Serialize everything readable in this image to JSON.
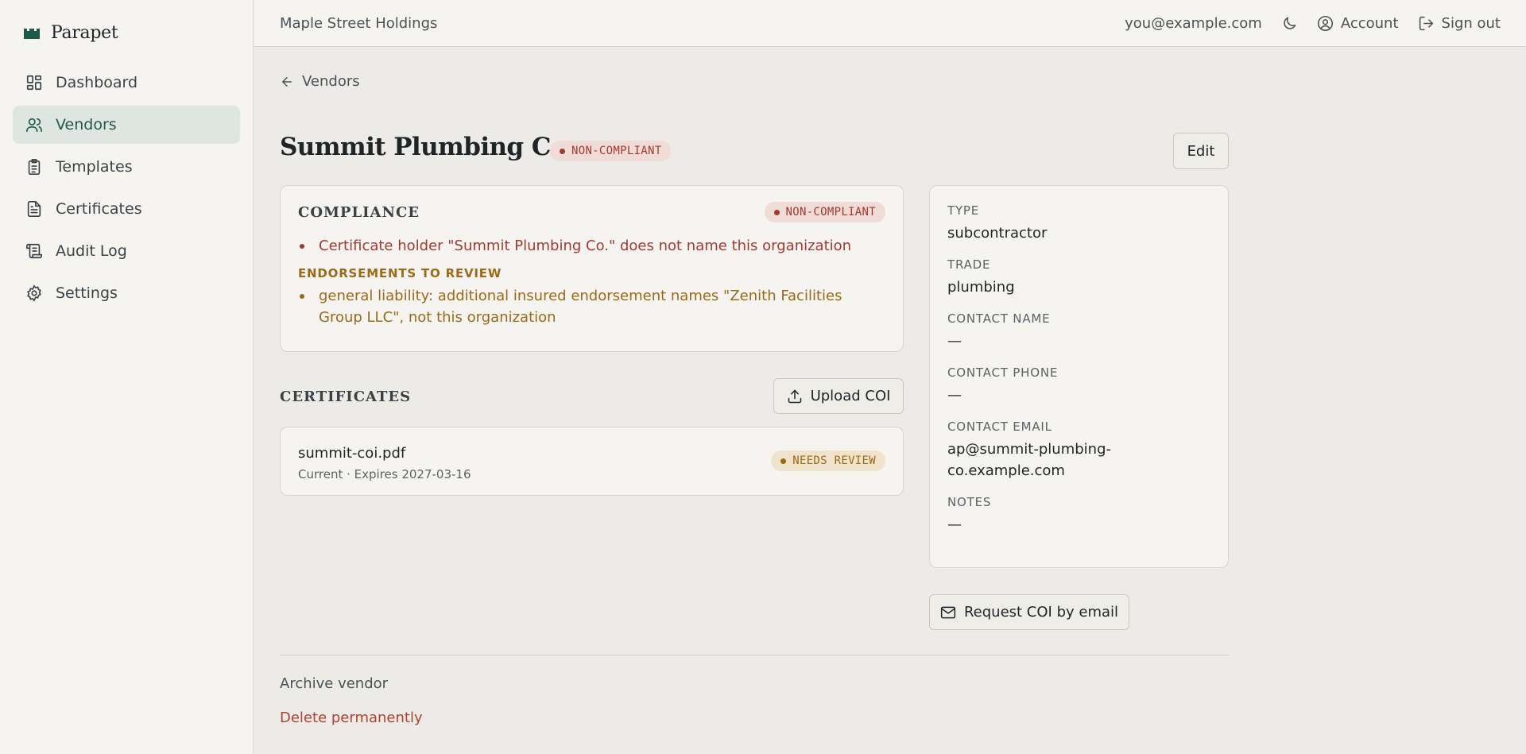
{
  "brand": {
    "name": "Parapet",
    "color": "#1d5a4c"
  },
  "sidebar": {
    "items": [
      {
        "label": "Dashboard",
        "icon": "dashboard-icon"
      },
      {
        "label": "Vendors",
        "icon": "users-icon",
        "active": true
      },
      {
        "label": "Templates",
        "icon": "clipboard-icon"
      },
      {
        "label": "Certificates",
        "icon": "document-icon"
      },
      {
        "label": "Audit Log",
        "icon": "scroll-icon"
      },
      {
        "label": "Settings",
        "icon": "gear-icon"
      }
    ]
  },
  "header": {
    "org_name": "Maple Street Holdings",
    "user_email": "you@example.com",
    "account_label": "Account",
    "signout_label": "Sign out"
  },
  "breadcrumb": {
    "back_label": "Vendors"
  },
  "vendor": {
    "name": "Summit Plumbing Co.",
    "status": "NON-COMPLIANT",
    "edit_label": "Edit"
  },
  "compliance": {
    "heading": "COMPLIANCE",
    "status": "NON-COMPLIANT",
    "issues": [
      "Certificate holder \"Summit Plumbing Co.\" does not name this organization"
    ],
    "endorsements_heading": "ENDORSEMENTS TO REVIEW",
    "endorsements": [
      "general liability: additional insured endorsement names \"Zenith Facilities Group LLC\", not this organization"
    ]
  },
  "certificates": {
    "heading": "CERTIFICATES",
    "upload_label": "Upload COI",
    "items": [
      {
        "filename": "summit-coi.pdf",
        "meta": "Current · Expires 2027-03-16",
        "status": "NEEDS REVIEW"
      }
    ]
  },
  "details": [
    {
      "label": "TYPE",
      "value": "subcontractor"
    },
    {
      "label": "TRADE",
      "value": "plumbing"
    },
    {
      "label": "CONTACT NAME",
      "value": "—"
    },
    {
      "label": "CONTACT PHONE",
      "value": "—"
    },
    {
      "label": "CONTACT EMAIL",
      "value": "ap@summit-plumbing-\nco.example.com"
    },
    {
      "label": "NOTES",
      "value": "—"
    }
  ],
  "actions": {
    "request_label": "Request COI by email",
    "archive_label": "Archive vendor",
    "delete_label": "Delete permanently"
  },
  "colors": {
    "accent": "#1d5a4c",
    "danger": "#a33a30",
    "warning": "#9a6a18"
  }
}
